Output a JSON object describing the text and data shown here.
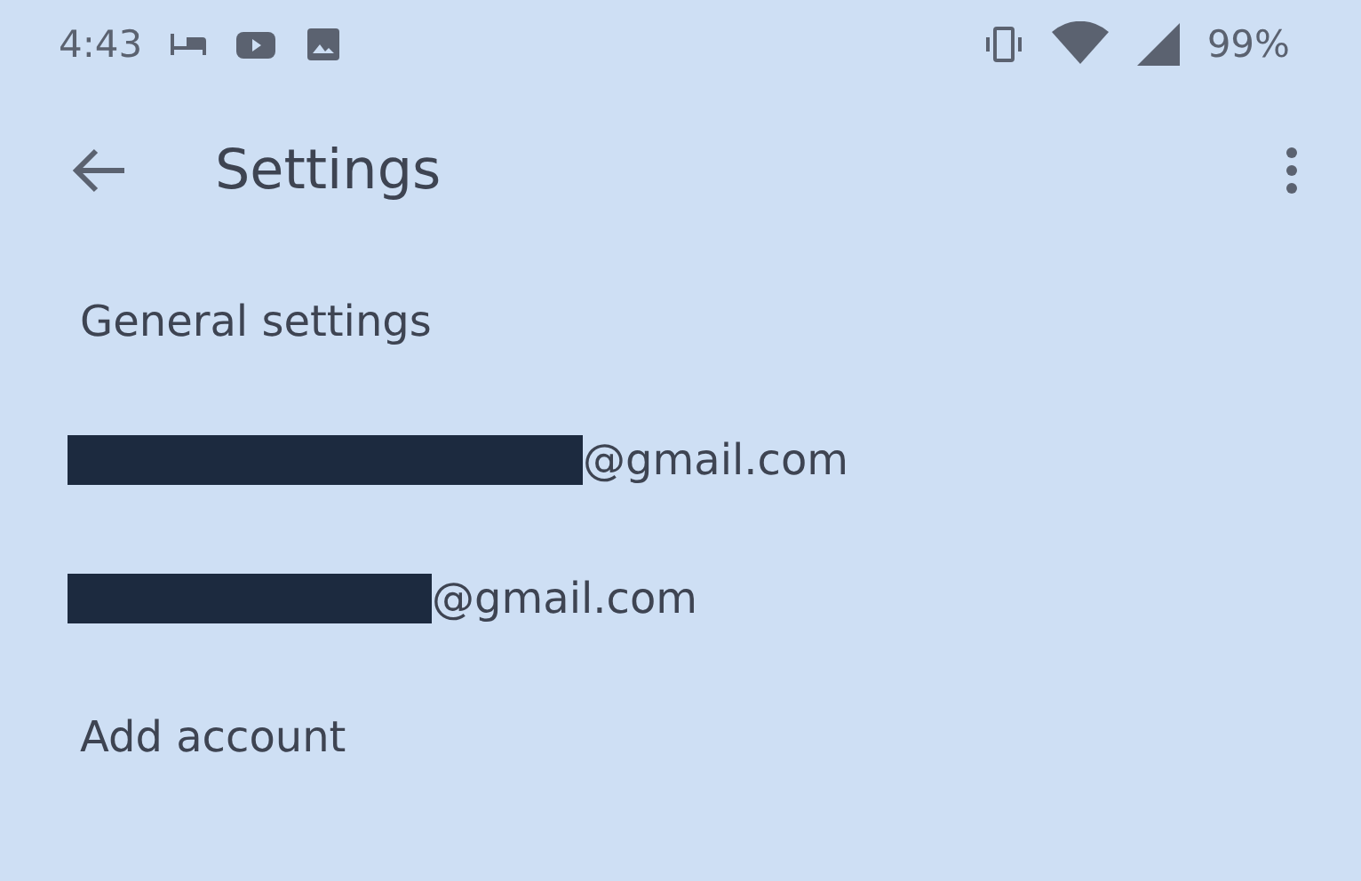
{
  "status_bar": {
    "time": "4:43",
    "battery": "99%"
  },
  "toolbar": {
    "title": "Settings"
  },
  "items": [
    {
      "kind": "text",
      "label": "General settings"
    },
    {
      "kind": "account",
      "label": "@gmail.com",
      "redacted": true
    },
    {
      "kind": "account",
      "label": "@gmail.com",
      "redacted": true
    },
    {
      "kind": "text",
      "label": "Add account"
    }
  ]
}
